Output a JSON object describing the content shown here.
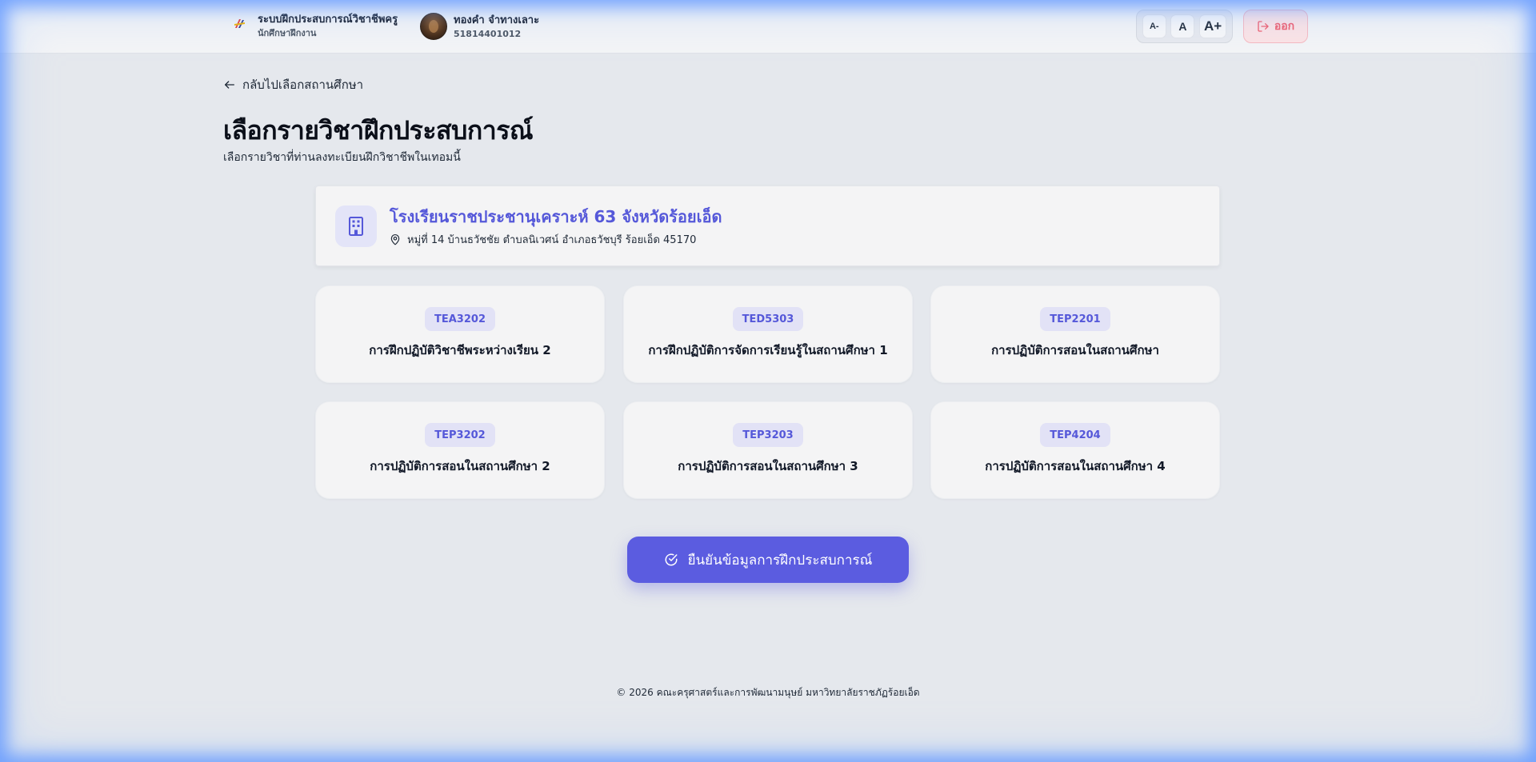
{
  "header": {
    "app_title": "ระบบฝึกประสบการณ์วิชาชีพครู",
    "role": "นักศึกษาฝึกงาน",
    "user_name": "ทองคำ จำทางเลาะ",
    "user_id": "51814401012",
    "font_controls": [
      "A-",
      "A",
      "A+"
    ],
    "logout_label": "ออก"
  },
  "nav": {
    "back_label": "กลับไปเลือกสถานศึกษา"
  },
  "page": {
    "title": "เลือกรายวิชาฝึกประสบการณ์",
    "subtitle": "เลือกรายวิชาที่ท่านลงทะเบียนฝึกวิชาชีพในเทอมนี้"
  },
  "school": {
    "name": "โรงเรียนราชประชานุเคราะห์ 63 จังหวัดร้อยเอ็ด",
    "address": "หมู่ที่ 14 บ้านธวัชชัย ตำบลนิเวศน์ อำเภอธวัชบุรี ร้อยเอ็ด 45170"
  },
  "courses": [
    {
      "code": "TEA3202",
      "name": "การฝึกปฏิบัติวิชาชีพระหว่างเรียน 2"
    },
    {
      "code": "TED5303",
      "name": "การฝึกปฏิบัติการจัดการเรียนรู้ในสถานศึกษา 1"
    },
    {
      "code": "TEP2201",
      "name": "การปฏิบัติการสอนในสถานศึกษา"
    },
    {
      "code": "TEP3202",
      "name": "การปฏิบัติการสอนในสถานศึกษา 2"
    },
    {
      "code": "TEP3203",
      "name": "การปฏิบัติการสอนในสถานศึกษา 3"
    },
    {
      "code": "TEP4204",
      "name": "การปฏิบัติการสอนในสถานศึกษา 4"
    }
  ],
  "confirm_label": "ยืนยันข้อมูลการฝึกประสบการณ์",
  "footer": "© 2026 คณะครุศาสตร์และการพัฒนามนุษย์ มหาวิทยาลัยราชภัฏร้อยเอ็ด",
  "colors": {
    "accent": "#5b5ce0",
    "logout": "#ef5f6f",
    "background": "#e5e8ed"
  },
  "icons": [
    "logo-icon",
    "logout-icon",
    "arrow-left-icon",
    "building-icon",
    "map-pin-icon",
    "check-circle-icon"
  ]
}
